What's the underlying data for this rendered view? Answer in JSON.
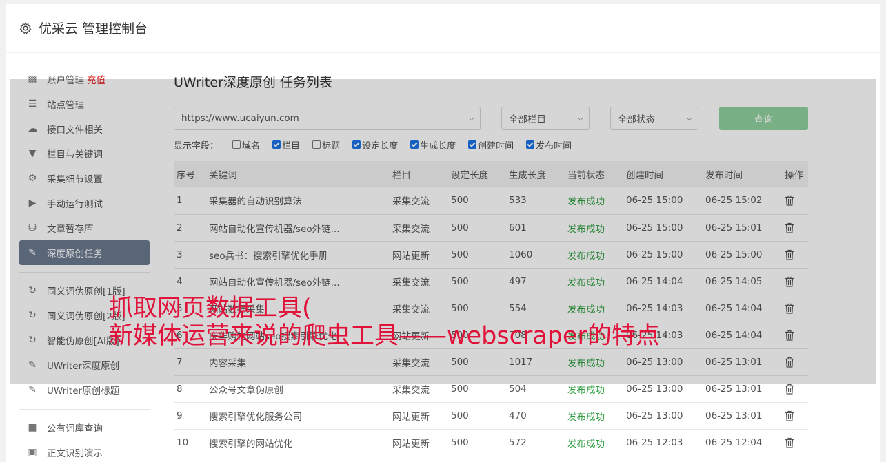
{
  "header": {
    "title": "优采云 管理控制台"
  },
  "sidebar": {
    "groups": [
      [
        {
          "label": "账户管理",
          "extra": "充值",
          "icon": "bar-chart-icon"
        },
        {
          "label": "站点管理",
          "icon": "server-icon"
        },
        {
          "label": "接口文件相关",
          "icon": "cloud-upload-icon"
        },
        {
          "label": "栏目与关键词",
          "icon": "filter-icon"
        },
        {
          "label": "采集细节设置",
          "icon": "gears-icon"
        },
        {
          "label": "手动运行测试",
          "icon": "play-circle-icon"
        },
        {
          "label": "文章暂存库",
          "icon": "database-icon"
        },
        {
          "label": "深度原创任务",
          "icon": "edit-icon",
          "active": true
        }
      ],
      [
        {
          "label": "同义词伪原创[1版]",
          "icon": "refresh-icon"
        },
        {
          "label": "同义词伪原创[2版]",
          "icon": "refresh-icon"
        },
        {
          "label": "智能伪原创[AI版]",
          "icon": "refresh-icon"
        },
        {
          "label": "UWriter深度原创",
          "icon": "edit-icon"
        },
        {
          "label": "UWriter原创标题",
          "icon": "edit-icon"
        }
      ],
      [
        {
          "label": "公有词库查询",
          "icon": "book-icon"
        },
        {
          "label": "正文识别演示",
          "icon": "monitor-icon"
        }
      ]
    ]
  },
  "main": {
    "title": "UWriter深度原创 任务列表",
    "site_select": "https://www.ucaiyun.com",
    "column_select": "全部栏目",
    "status_select": "全部状态",
    "query_button": "查询",
    "fields_label": "显示字段：",
    "fields": [
      {
        "label": "域名",
        "checked": false
      },
      {
        "label": "栏目",
        "checked": true
      },
      {
        "label": "标题",
        "checked": false
      },
      {
        "label": "设定长度",
        "checked": true
      },
      {
        "label": "生成长度",
        "checked": true
      },
      {
        "label": "创建时间",
        "checked": true
      },
      {
        "label": "发布时间",
        "checked": true
      }
    ],
    "table": {
      "headers": [
        "序号",
        "关键词",
        "栏目",
        "设定长度",
        "生成长度",
        "当前状态",
        "创建时间",
        "发布时间",
        "操作"
      ],
      "rows": [
        [
          "1",
          "采集器的自动识别算法",
          "采集交流",
          "500",
          "533",
          "发布成功",
          "06-25 15:00",
          "06-25 15:02"
        ],
        [
          "2",
          "网站自动化宣传机器/seo外链...",
          "采集交流",
          "500",
          "601",
          "发布成功",
          "06-25 15:00",
          "06-25 15:01"
        ],
        [
          "3",
          "seo兵书：搜索引擎优化手册",
          "网站更新",
          "500",
          "1060",
          "发布成功",
          "06-25 15:00",
          "06-25 15:00"
        ],
        [
          "4",
          "网站自动化宣传机器/seo外链...",
          "采集交流",
          "500",
          "497",
          "发布成功",
          "06-25 14:04",
          "06-25 14:05"
        ],
        [
          "5",
          "网站数据采集",
          "采集交流",
          "500",
          "554",
          "发布成功",
          "06-25 14:03",
          "06-25 14:04"
        ],
        [
          "6",
          "庆华购物网站seo搜索引擎优化",
          "网站更新",
          "500",
          "708",
          "发布成功",
          "06-25 14:03",
          "06-25 14:04"
        ],
        [
          "7",
          "内容采集",
          "采集交流",
          "500",
          "1017",
          "发布成功",
          "06-25 13:00",
          "06-25 13:01"
        ],
        [
          "8",
          "公众号文章伪原创",
          "采集交流",
          "500",
          "504",
          "发布成功",
          "06-25 13:00",
          "06-25 13:01"
        ],
        [
          "9",
          "搜索引擎优化服务公司",
          "网站更新",
          "500",
          "470",
          "发布成功",
          "06-25 13:00",
          "06-25 13:01"
        ],
        [
          "10",
          "搜索引擎的网站优化",
          "网站更新",
          "500",
          "572",
          "发布成功",
          "06-25 12:03",
          "06-25 12:04"
        ]
      ]
    }
  },
  "overlay": {
    "line1": "抓取网页数据工具(",
    "line2": "新媒体运营来说的爬虫工具——webscraper的特点"
  },
  "colors": {
    "active_bg": "#6b7a8f",
    "query_btn": "#8fd19e",
    "success": "#2e9e3f",
    "caption": "#e0123a",
    "recharge": "#e02020"
  }
}
